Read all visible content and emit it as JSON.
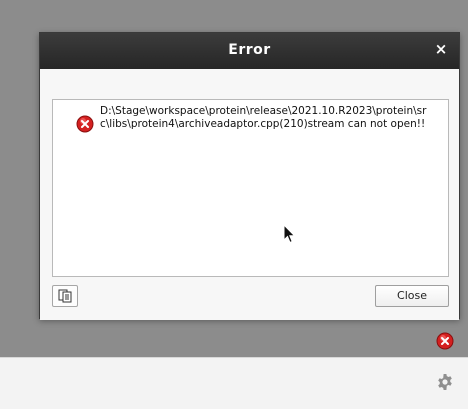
{
  "dialog": {
    "title": "Error",
    "close_symbol": "×",
    "message": "D:\\Stage\\workspace\\protein\\release\\2021.10.R2023\\protein\\src\\libs\\protein4\\archiveadaptor.cpp(210)stream can not open!!",
    "close_label": "Close",
    "icons": {
      "message": "error-icon",
      "copy": "copy-icon"
    }
  },
  "background": {
    "icons": [
      "error-icon",
      "gear-icon"
    ]
  },
  "colors": {
    "titlebar": "#2e2e2e",
    "error_red": "#d42020",
    "backdrop": "#8c8c8c"
  }
}
